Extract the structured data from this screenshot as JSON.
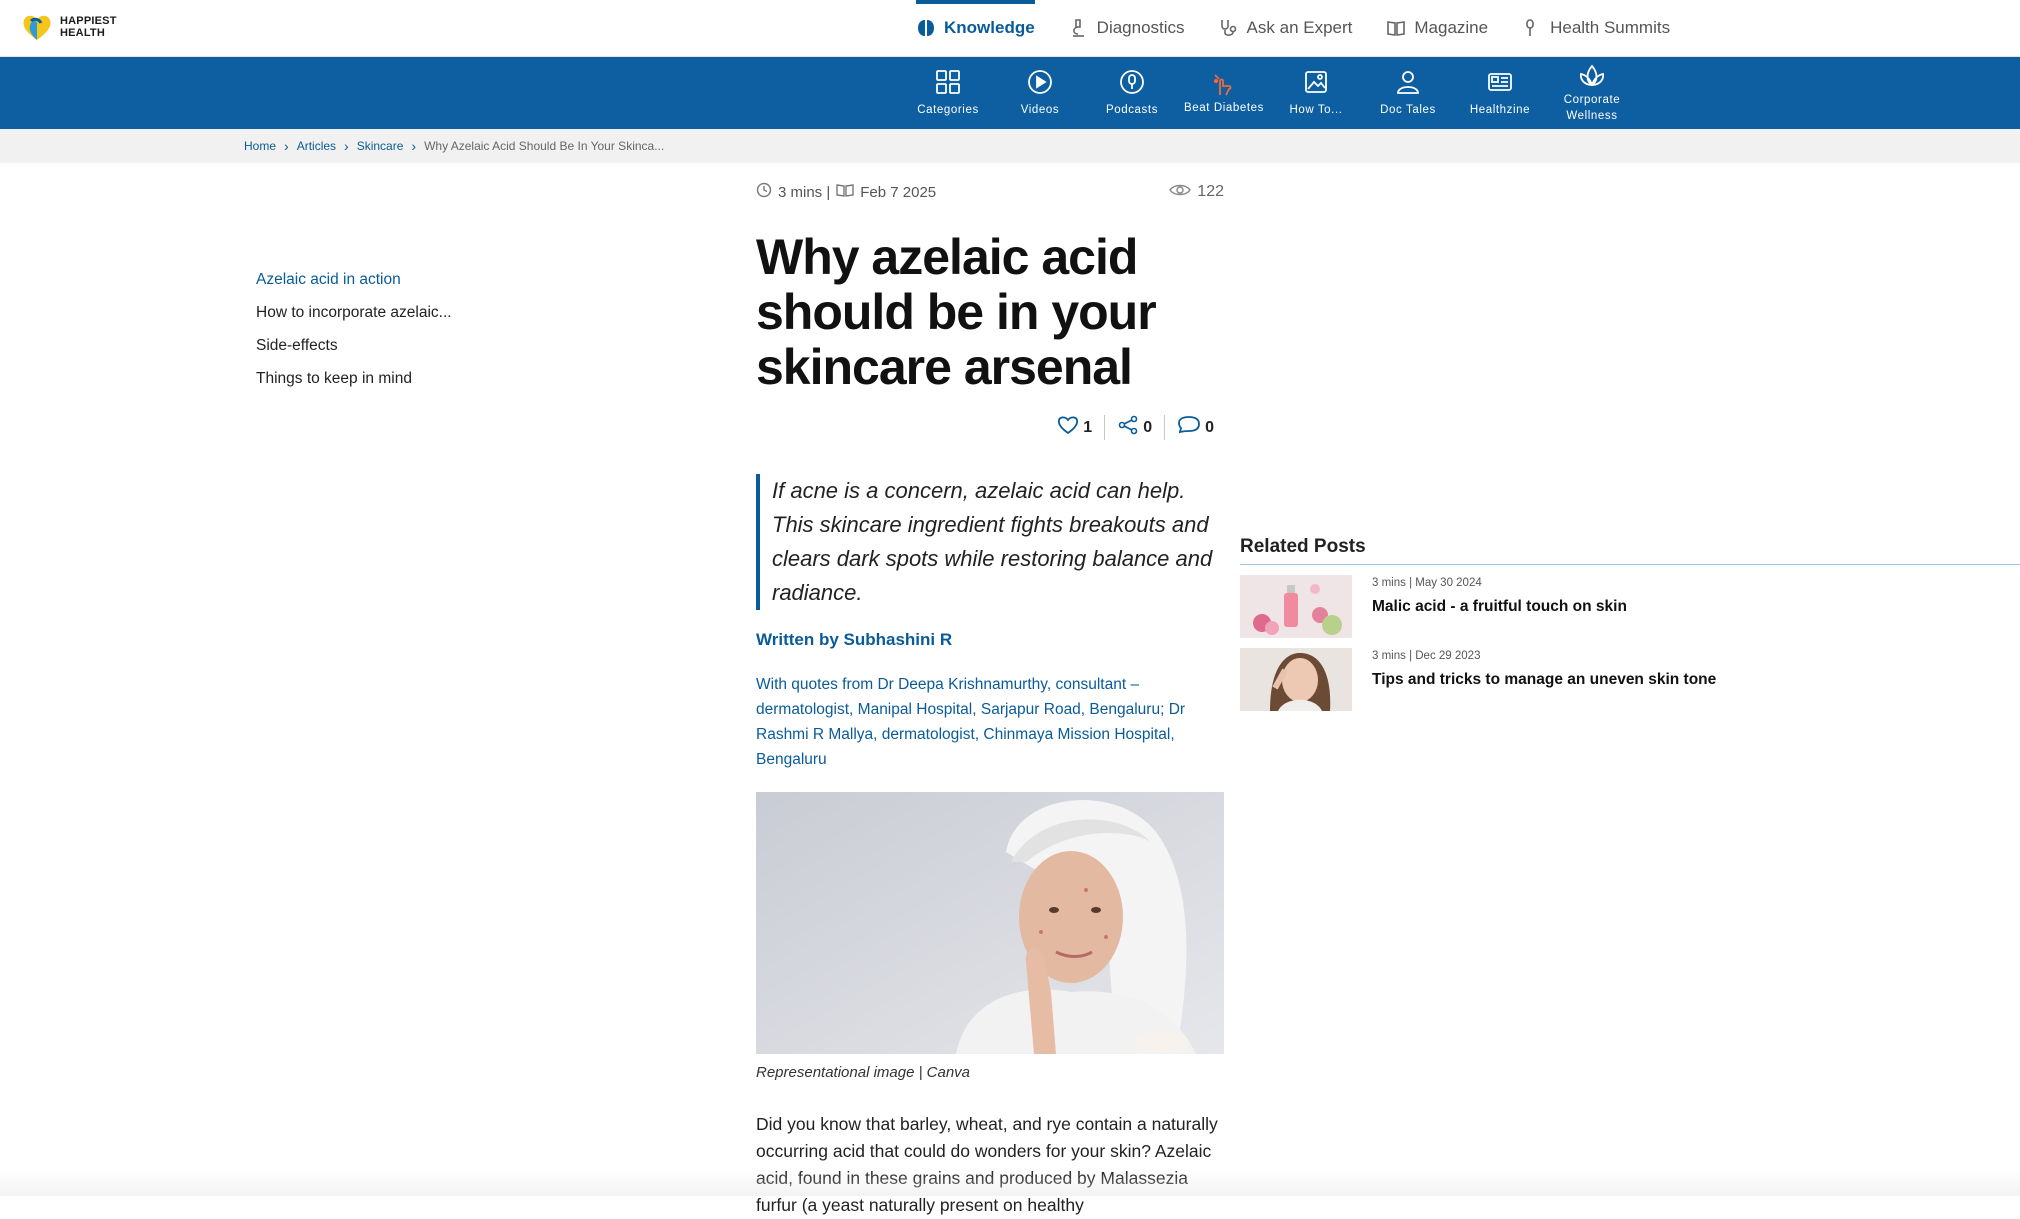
{
  "brand": {
    "line1": "HAPPIEST",
    "line2": "HEALTH"
  },
  "topnav": [
    {
      "label": "Knowledge",
      "icon": "brain-icon",
      "active": true
    },
    {
      "label": "Diagnostics",
      "icon": "microscope-icon"
    },
    {
      "label": "Ask an Expert",
      "icon": "stethoscope-icon"
    },
    {
      "label": "Magazine",
      "icon": "book-icon"
    },
    {
      "label": "Health Summits",
      "icon": "mic-icon"
    }
  ],
  "subnav": [
    {
      "label": "Categories",
      "icon": "grid-icon"
    },
    {
      "label": "Videos",
      "icon": "play-icon"
    },
    {
      "label": "Podcasts",
      "icon": "podcast-icon"
    },
    {
      "label": "Beat Diabetes",
      "icon": "finger-prick-icon",
      "accent": "#f06a3a"
    },
    {
      "label": "How To...",
      "icon": "image-icon"
    },
    {
      "label": "Doc Tales",
      "icon": "doctor-icon"
    },
    {
      "label": "Healthzine",
      "icon": "newspaper-icon"
    },
    {
      "label": "Corporate Wellness",
      "icon": "lotus-icon"
    }
  ],
  "breadcrumb": {
    "home": "Home",
    "articles": "Articles",
    "category": "Skincare",
    "current": "Why Azelaic Acid Should Be In Your Skinca..."
  },
  "toc": [
    "Azelaic acid in action",
    "How to incorporate azelaic...",
    "Side-effects",
    "Things to keep in mind"
  ],
  "article": {
    "read_time": "3 mins |",
    "date": "Feb 7 2025",
    "views": "122",
    "title": "Why azelaic acid should be in your skincare arsenal",
    "likes": "1",
    "shares": "0",
    "comments": "0",
    "summary": "If acne is a concern, azelaic acid can help. This skincare ingredient fights breakouts and clears dark spots while restoring balance and radiance.",
    "author": "Written by Subhashini R",
    "quotes_from": "With quotes from Dr Deepa Krishnamurthy, consultant – dermatologist, Manipal Hospital, Sarjapur Road, Bengaluru; Dr Rashmi R Mallya, dermatologist, Chinmaya Mission Hospital, Bengaluru",
    "caption": "Representational image | Canva",
    "body": "Did you know that barley, wheat, and rye contain a naturally occurring acid that could do wonders for your skin? Azelaic acid, found in these grains and produced by Malassezia furfur (a yeast naturally present on healthy"
  },
  "related": {
    "title": "Related Posts",
    "items": [
      {
        "meta": "3 mins | May 30 2024",
        "title": "Malic acid - a fruitful touch on skin"
      },
      {
        "meta": "3 mins | Dec 29 2023",
        "title": "Tips and tricks to manage an uneven skin tone"
      }
    ]
  },
  "colors": {
    "brand_blue": "#0e5fa1",
    "link_blue": "#0a5b99",
    "accent_orange": "#f06a3a"
  }
}
